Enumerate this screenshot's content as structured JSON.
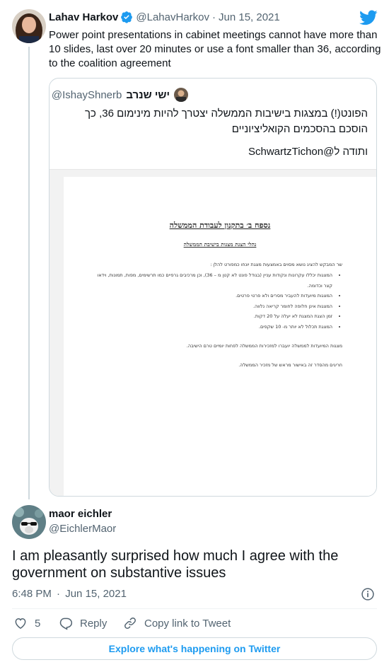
{
  "original_tweet": {
    "author_name": "Lahav Harkov",
    "handle": "@LahavHarkov",
    "separator": "·",
    "date": "Jun 15, 2021",
    "text": "Power point presentations in cabinet meetings cannot have more than 10 slides, last over 20 minutes or use a font smaller than 36, according to the coalition agreement"
  },
  "quoted_tweet": {
    "author_name": "ישי שנרב",
    "handle": "@IshayShnerb",
    "text_line1": "הפונט(!) במצגות בישיבות הממשלה יצטרך להיות מינימום 36, כך הוסכם בהסכמים הקואליציוניים",
    "text_line2": "ותודה ל@SchwartzTichon"
  },
  "document": {
    "title": "נספח ב׳ בתקנון לעבודת הממשלה",
    "subtitle": "נהלי הצגת מצגות בישיבת הממשלה",
    "intro": "שר המבקש להציג נושא מסוים באמצעות מצגת יונחו כמפורט להלן :",
    "bullets": [
      "המצגות יכללו עקרונות ונקודות עניין (בגודל פונט לא קטן מ – 36), וכן מרכיבים גרפיים כמו תרשימים, מפות, תמונות, וידאו קצר וכדומה.",
      "המצגות מיועדות להעביר מסרים ולא פרטי פרטים.",
      "המצגות אינן חלופה לחומר קריאה נלווה.",
      "זמן הצגת המצגת לא יעלה על 20 דקות.",
      "המצגת תכלול לא יותר מ- 10 שקפים."
    ],
    "para1": "מצגות המיועדות לממשלה יועברו למזכירות הממשלה לפחות יומיים טרם הישיבה.",
    "para2": "חריגים מהסדר זה באישור מראש של מזכיר הממשלה."
  },
  "reply_tweet": {
    "author_name": "maor eichler",
    "handle": "@EichlerMaor",
    "text": "I am pleasantly surprised how much I agree with the government on substantive issues",
    "time": "6:48 PM",
    "separator": "·",
    "date": "Jun 15, 2021"
  },
  "actions": {
    "like_count": "5",
    "reply_label": "Reply",
    "copy_label": "Copy link to Tweet"
  },
  "explore_label": "Explore what's happening on Twitter",
  "icons": {
    "brand": "twitter-bird-icon",
    "verified": "verified-badge-icon",
    "info": "info-icon",
    "like": "heart-icon",
    "reply": "speech-bubble-icon",
    "copy": "link-icon"
  },
  "colors": {
    "twitter_blue": "#1d9bf0",
    "text_primary": "#0f1419",
    "text_secondary": "#536471",
    "border": "#cfd9de"
  }
}
